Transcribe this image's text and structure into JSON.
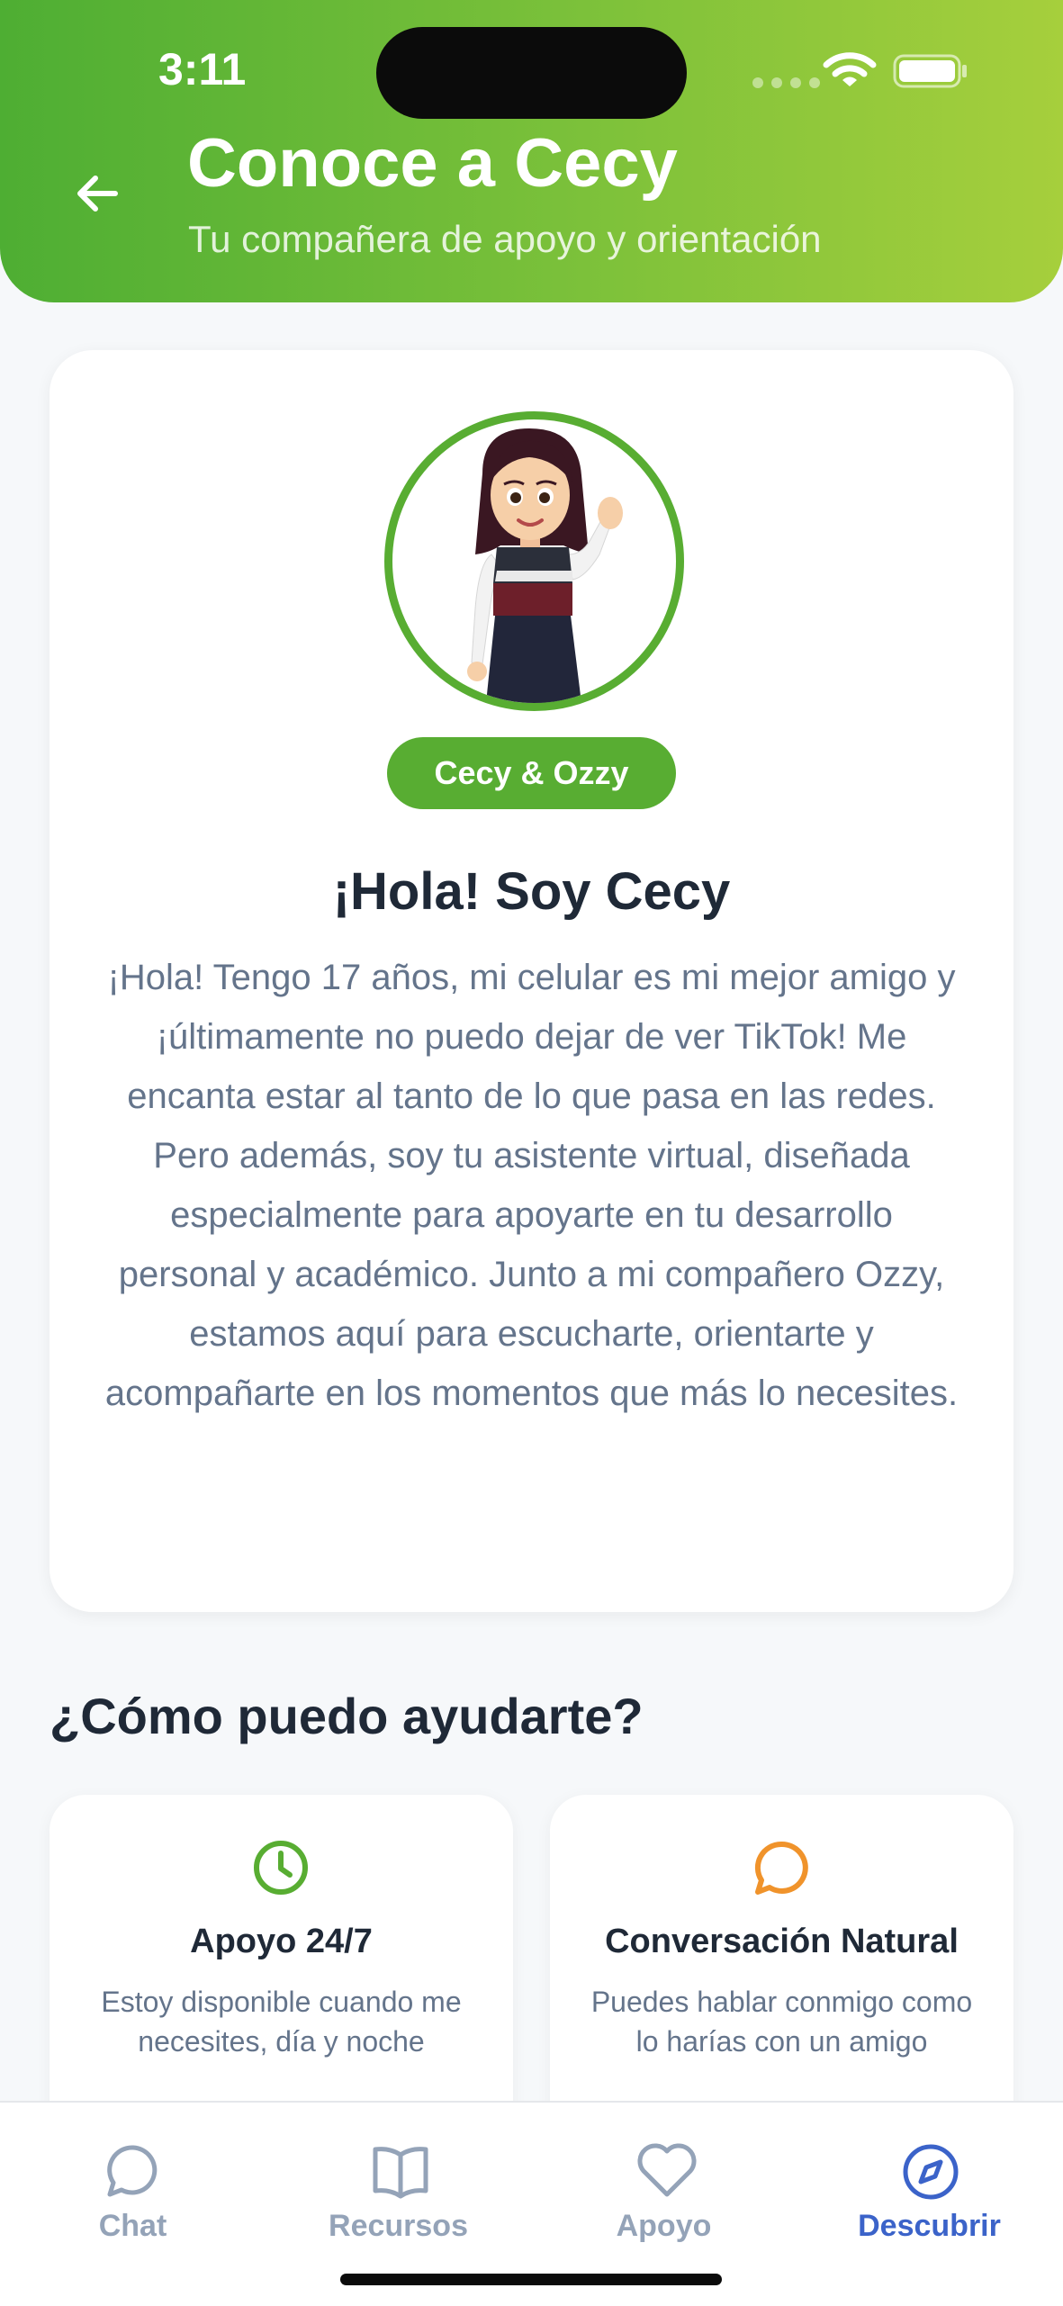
{
  "status_bar": {
    "time": "3:11"
  },
  "header": {
    "title": "Conoce a Cecy",
    "subtitle": "Tu compañera de apoyo y orientación",
    "back_icon": "arrow-left-icon"
  },
  "profile": {
    "avatar": "cecy-avatar",
    "badge": "Cecy & Ozzy",
    "greeting": "¡Hola! Soy Cecy",
    "bio": "¡Hola! Tengo 17 años, mi celular es mi mejor amigo y ¡últimamente no puedo dejar de ver TikTok! Me encanta estar al tanto de lo que pasa en las redes. Pero además, soy tu asistente virtual, diseñada especialmente para apoyarte en tu desarrollo personal y académico. Junto a mi compañero Ozzy, estamos aquí para escucharte, orientarte y acompañarte en los momentos que más lo necesites."
  },
  "help_section": {
    "title": "¿Cómo puedo ayudarte?",
    "features": [
      {
        "icon": "clock-icon",
        "title": "Apoyo 24/7",
        "description": "Estoy disponible cuando me necesites, día y noche",
        "color": "#58ad32"
      },
      {
        "icon": "chat-bubble-icon",
        "title": "Conversación Natural",
        "description": "Puedes hablar conmigo como lo harías con un amigo",
        "color": "#f0932b"
      }
    ]
  },
  "tabbar": {
    "tabs": [
      {
        "label": "Chat",
        "icon": "chat-bubble-icon",
        "active": false
      },
      {
        "label": "Recursos",
        "icon": "book-icon",
        "active": false
      },
      {
        "label": "Apoyo",
        "icon": "heart-icon",
        "active": false
      },
      {
        "label": "Descubrir",
        "icon": "compass-icon",
        "active": true
      }
    ]
  },
  "colors": {
    "brand_green": "#58ad32",
    "active_tab": "#3b63c9",
    "inactive_tab": "#94a3b8",
    "feature_orange": "#f0932b"
  }
}
